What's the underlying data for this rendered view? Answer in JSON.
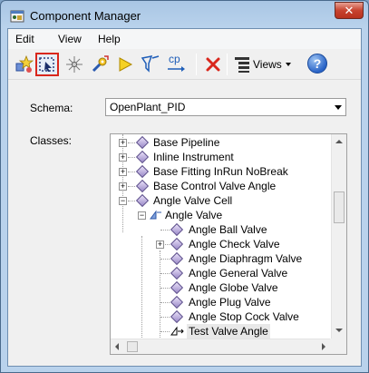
{
  "window": {
    "title": "Component Manager",
    "close_glyph": "✕"
  },
  "menu": {
    "items": [
      "Edit",
      "View",
      "Help"
    ]
  },
  "toolbar": {
    "buttons": [
      "new-class-icon",
      "select-icon",
      "sparkle-icon",
      "wrench-icon",
      "play-icon",
      "filter-icon",
      "copy-icon",
      "delete-icon"
    ],
    "copy_label": "cp",
    "views_label": "Views",
    "help_glyph": "?"
  },
  "schema": {
    "label": "Schema:",
    "value": "OpenPlant_PID"
  },
  "classes": {
    "label": "Classes:",
    "rows": [
      {
        "text": "Base Pipeline"
      },
      {
        "text": "Inline Instrument"
      },
      {
        "text": "Base Fitting InRun NoBreak"
      },
      {
        "text": "Base Control Valve Angle"
      },
      {
        "text": "Angle Valve Cell"
      },
      {
        "text": "Angle Valve"
      },
      {
        "text": "Angle Ball Valve"
      },
      {
        "text": "Angle Check Valve"
      },
      {
        "text": "Angle Diaphragm Valve"
      },
      {
        "text": "Angle General Valve"
      },
      {
        "text": "Angle Globe Valve"
      },
      {
        "text": "Angle Plug Valve"
      },
      {
        "text": "Angle Stop Cock Valve"
      },
      {
        "text": "Test Valve Angle"
      }
    ]
  },
  "colors": {
    "selected_border": "#d9271c",
    "accent": "#2a64c7",
    "delete": "#d9271c"
  }
}
